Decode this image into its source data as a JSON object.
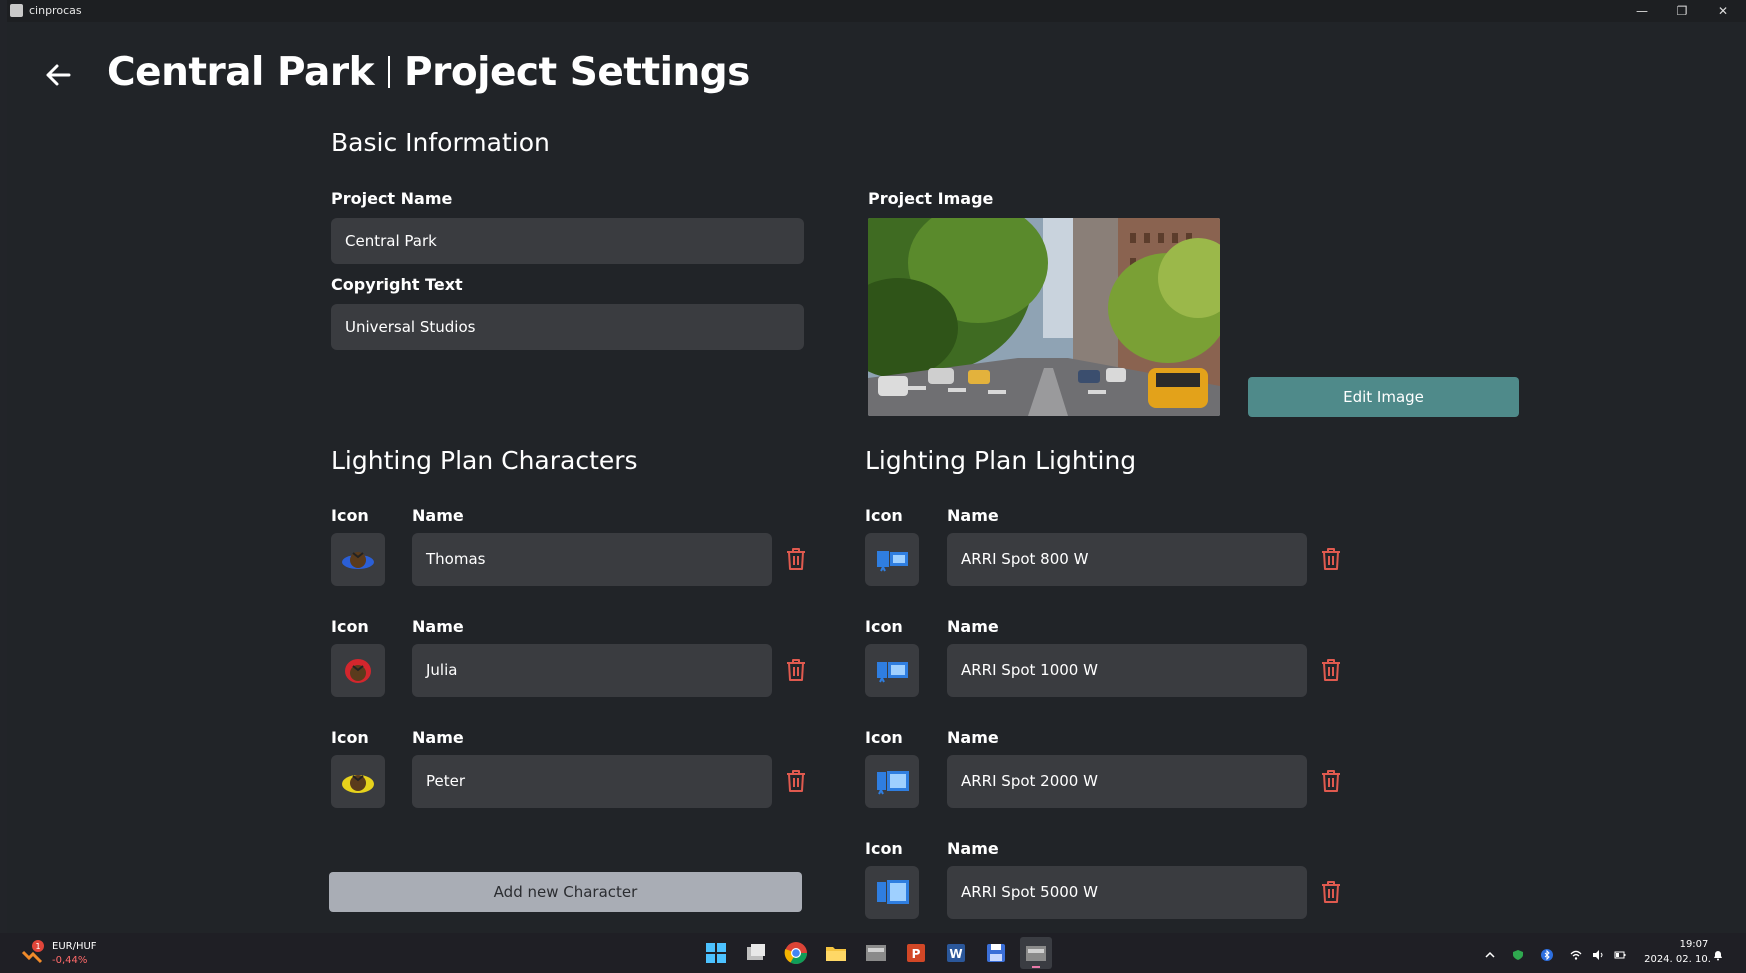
{
  "window": {
    "title": "cinprocas",
    "minimize_glyph": "—",
    "restore_glyph": "❐",
    "close_glyph": "✕"
  },
  "header": {
    "project_name": "Central Park",
    "page": "Project Settings",
    "back_icon": "arrow-left-icon"
  },
  "basic_info": {
    "section_title": "Basic Information",
    "project_name_label": "Project Name",
    "project_name_value": "Central Park",
    "copyright_label": "Copyright Text",
    "copyright_value": "Universal Studios",
    "image_label": "Project Image",
    "edit_image_label": "Edit Image"
  },
  "characters": {
    "section_title": "Lighting Plan Characters",
    "icon_label": "Icon",
    "name_label": "Name",
    "items": [
      {
        "name": "Thomas",
        "icon": "character-blue-icon",
        "color": "#2b5fd6"
      },
      {
        "name": "Julia",
        "icon": "character-red-icon",
        "color": "#d3262d"
      },
      {
        "name": "Peter",
        "icon": "character-yellow-icon",
        "color": "#e7d21c"
      }
    ],
    "add_button": "Add new Character"
  },
  "lighting": {
    "section_title": "Lighting Plan Lighting",
    "icon_label": "Icon",
    "name_label": "Name",
    "items": [
      {
        "name": "ARRI Spot 800 W",
        "icon": "spotlight-icon"
      },
      {
        "name": "ARRI Spot 1000 W",
        "icon": "spotlight-icon"
      },
      {
        "name": "ARRI Spot 2000 W",
        "icon": "spotlight-icon"
      },
      {
        "name": "ARRI Spot 5000 W",
        "icon": "spotlight-icon"
      }
    ]
  },
  "colors": {
    "accent": "#4f8a8a",
    "delete": "#e05a4f",
    "field_bg": "#3a3c40",
    "page_bg": "#212428"
  },
  "taskbar": {
    "ticker_badge": "1",
    "ticker_name": "EUR/HUF",
    "ticker_change": "-0,44%",
    "time": "19:07",
    "date": "2024. 02. 10."
  }
}
